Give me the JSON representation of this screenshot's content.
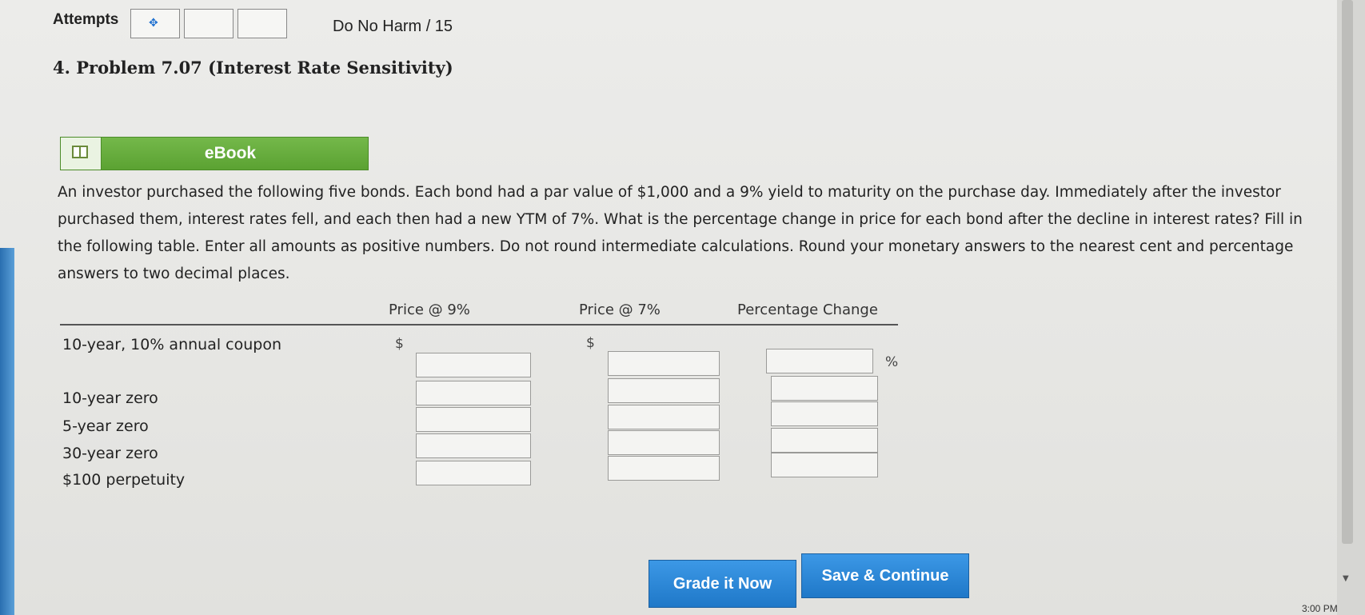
{
  "header": {
    "attempts_label": "Attempts",
    "attempt_icon": "move-icon",
    "score": "Do No Harm / 15"
  },
  "problem": {
    "title": "4.  Problem 7.07 (Interest Rate Sensitivity)",
    "ebook_label": "eBook",
    "ebook_icon": "book-icon",
    "question": "An investor purchased the following five bonds. Each bond had a par value of $1,000 and a 9% yield to maturity on the purchase day. Immediately after the investor purchased them, interest rates fell, and each then had a new YTM of 7%. What is the percentage change in price for each bond after the decline in interest rates? Fill in the following table. Enter all amounts as positive numbers. Do not round intermediate calculations. Round your monetary answers to the nearest cent and percentage answers to two decimal places."
  },
  "table": {
    "headers": [
      "Price @ 9%",
      "Price @ 7%",
      "Percentage Change"
    ],
    "rows": [
      {
        "label": "10-year, 10% annual coupon"
      },
      {
        "label": "10-year zero"
      },
      {
        "label": "5-year zero"
      },
      {
        "label": "30-year zero"
      },
      {
        "label": "$100 perpetuity"
      }
    ],
    "currency_symbol": "$",
    "percent_symbol": "%"
  },
  "actions": {
    "grade_label": "Grade it Now",
    "save_label": "Save & Continue"
  },
  "system": {
    "clock": "3:00 PM"
  }
}
